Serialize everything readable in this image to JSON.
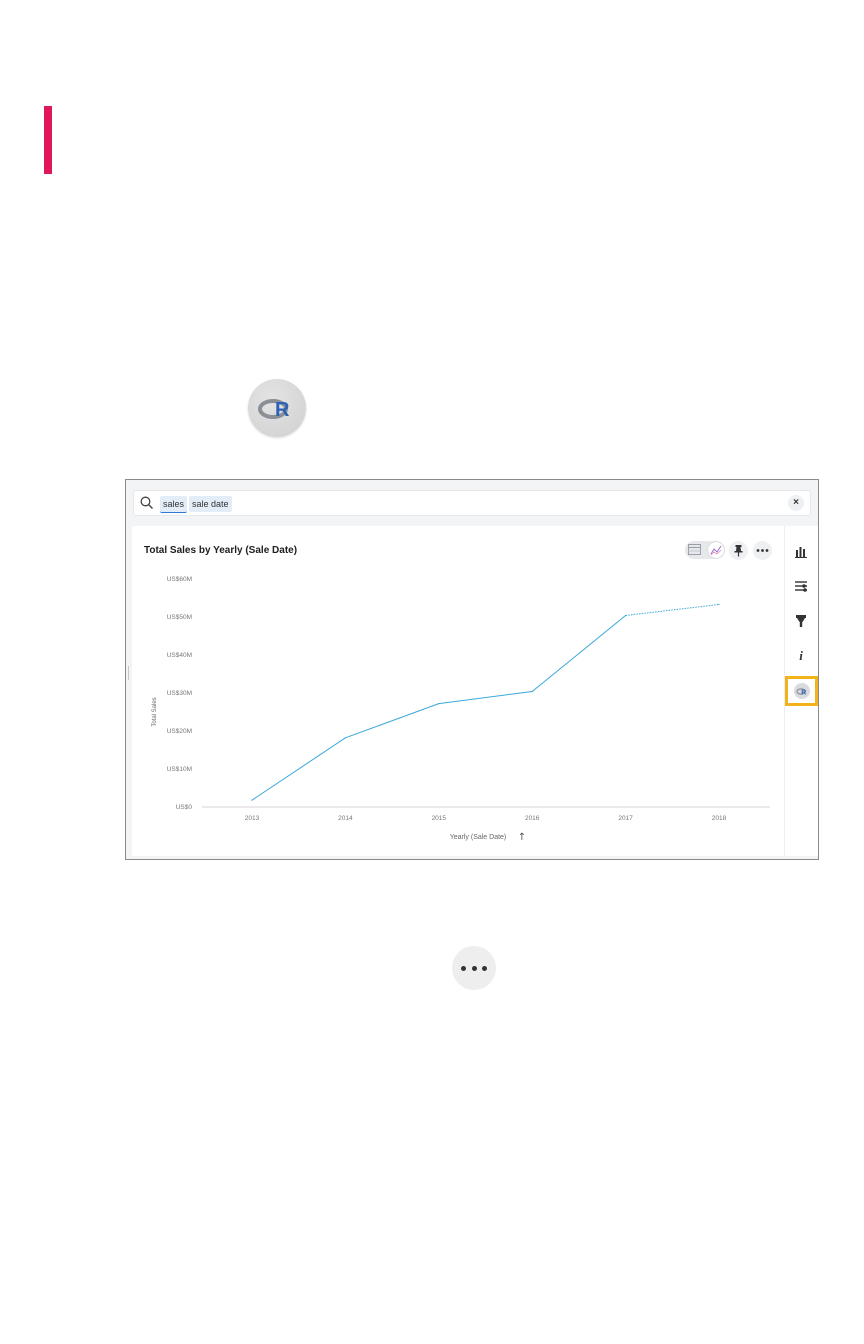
{
  "colors": {
    "accent": "#e0185a",
    "line": "#3aa9d8",
    "highlight": "#f2b21a",
    "r_logo": "#2b61b7"
  },
  "icons": {
    "r_logo_large": "r-language-logo-icon",
    "more_large": "more-options-icon"
  },
  "r_logo_letter": "R",
  "search": {
    "icon": "search-icon",
    "tokens": [
      "sales",
      "sale date"
    ],
    "clear_label": "×"
  },
  "answer": {
    "title": "Total Sales by Yearly (Sale Date)",
    "view_toggle": {
      "options": [
        "table-view-icon",
        "chart-view-icon"
      ],
      "selected": "chart"
    },
    "actions": [
      "pin-icon",
      "more-icon"
    ]
  },
  "right_rail": {
    "items": [
      {
        "name": "chart-type-icon"
      },
      {
        "name": "configure-icon"
      },
      {
        "name": "filter-icon"
      },
      {
        "name": "info-icon",
        "label": "i"
      },
      {
        "name": "r-analysis-icon",
        "label": "R",
        "highlighted": true
      }
    ]
  },
  "chart_data": {
    "type": "line",
    "title": "Total Sales by Yearly (Sale Date)",
    "xlabel": "Yearly (Sale Date)",
    "ylabel": "Total Sales",
    "sort_indicator": "↑",
    "categories": [
      "2013",
      "2014",
      "2015",
      "2016",
      "2017",
      "2018"
    ],
    "series": [
      {
        "values": [
          1.8,
          18.2,
          27.2,
          30.4,
          50.4,
          53.3
        ]
      }
    ],
    "last_segment_style": "dotted",
    "yticks": [
      "US$0",
      "US$10M",
      "US$20M",
      "US$30M",
      "US$40M",
      "US$50M",
      "US$60M"
    ],
    "ylim": [
      0,
      60
    ],
    "ytick_values": [
      0,
      10,
      20,
      30,
      40,
      50,
      60
    ],
    "grid": false,
    "legend": "none"
  }
}
